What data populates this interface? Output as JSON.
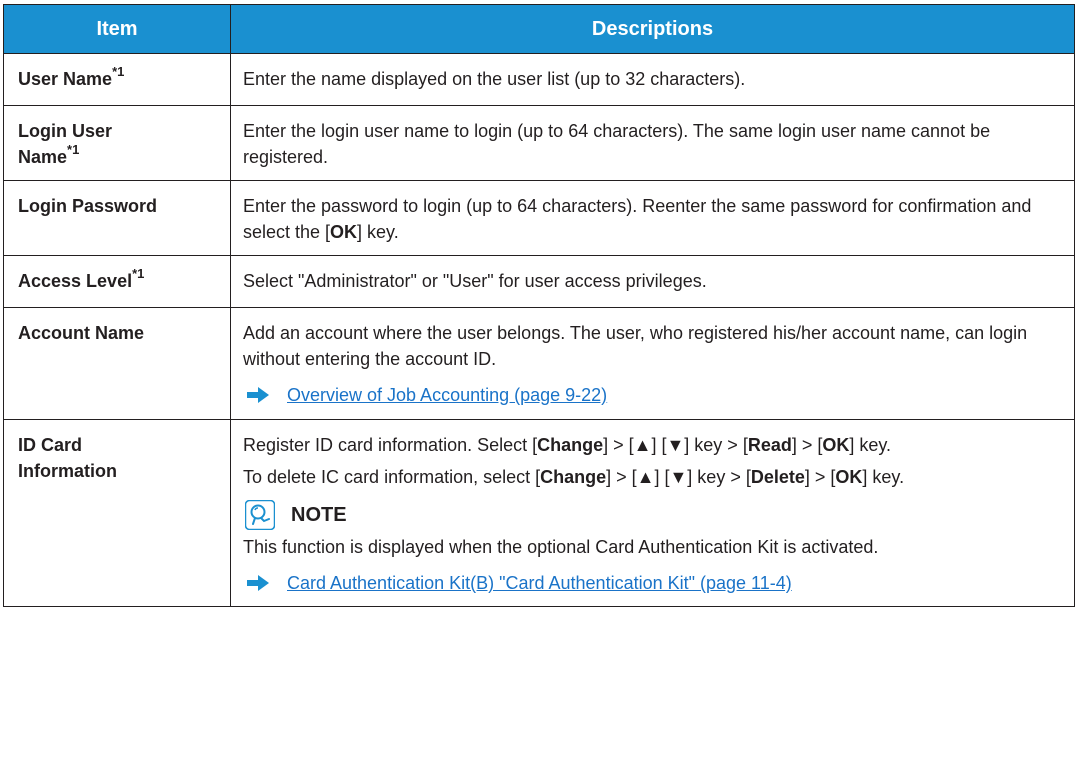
{
  "header": {
    "col1": "Item",
    "col2": "Descriptions"
  },
  "footnote_marker": "*1",
  "rows": {
    "user_name": {
      "item": "User Name",
      "desc": "Enter the name displayed on the user list (up to 32 characters)."
    },
    "login_user_name": {
      "item_line1": "Login User",
      "item_line2": "Name",
      "desc": "Enter the login user name to login (up to 64 characters). The same login user name cannot be registered."
    },
    "login_password": {
      "item": "Login Password",
      "desc_a": "Enter the password to login (up to 64 characters). Reenter the same password for confirmation and select the [",
      "desc_key": "OK",
      "desc_b": "] key."
    },
    "access_level": {
      "item": "Access Level",
      "desc": "Select \"Administrator\" or \"User\" for user access privileges."
    },
    "account_name": {
      "item": "Account Name",
      "desc": "Add an account where the user belongs. The user, who registered his/her account name, can login without entering the account ID.",
      "link": "Overview of Job Accounting (page 9-22)"
    },
    "id_card": {
      "item_line1": "ID Card",
      "item_line2": "Information",
      "p1": {
        "t1": "Register ID card information. Select [",
        "k1": "Change",
        "t2": "] > [▲] [▼] key > [",
        "k2": "Read",
        "t3": "] > [",
        "k3": "OK",
        "t4": "] key."
      },
      "p2": {
        "t1": "To delete IC card information, select [",
        "k1": "Change",
        "t2": "] > [▲] [▼] key > [",
        "k2": "Delete",
        "t3": "] > [",
        "k3": "OK",
        "t4": "] key."
      },
      "note_label": "NOTE",
      "note_text": "This function is displayed when the optional Card Authentication Kit is activated.",
      "link": "Card Authentication Kit(B) \"Card Authentication Kit\" (page 11-4)"
    }
  },
  "colors": {
    "header_bg": "#1a90d0",
    "link": "#1a73c8",
    "arrow": "#1a90d0"
  }
}
